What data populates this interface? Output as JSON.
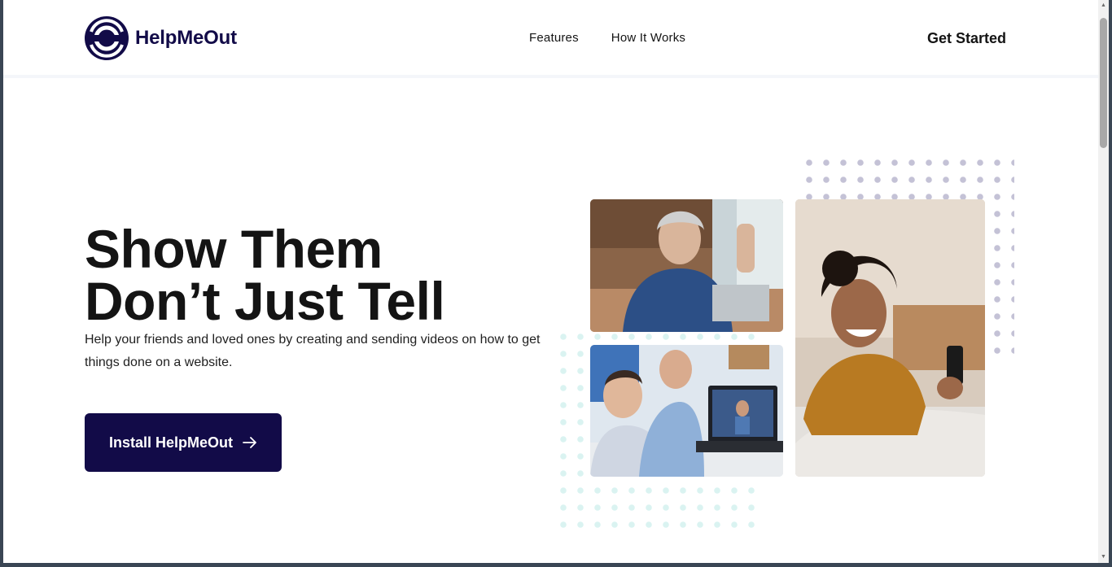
{
  "brand": {
    "name": "HelpMeOut",
    "logo_icon": "helpmeout-logo-icon",
    "color": "#120b48"
  },
  "nav": {
    "links": [
      {
        "label": "Features"
      },
      {
        "label": "How It Works"
      }
    ],
    "cta_label": "Get Started"
  },
  "hero": {
    "title_line1": "Show Them",
    "title_line2": "Don’t Just Tell",
    "subtitle": "Help your friends and loved ones by creating and sending videos on how to get things done on a website.",
    "button_label": "Install HelpMeOut",
    "button_icon": "arrow-right-icon"
  },
  "images": [
    {
      "name": "photo-woman-laptop-headphones"
    },
    {
      "name": "photo-grandpa-child-laptop"
    },
    {
      "name": "photo-woman-phone-couch"
    }
  ],
  "colors": {
    "accent": "#120b48",
    "dots_top": "#c4c2d6",
    "dots_bottom": "#daf3f1"
  }
}
